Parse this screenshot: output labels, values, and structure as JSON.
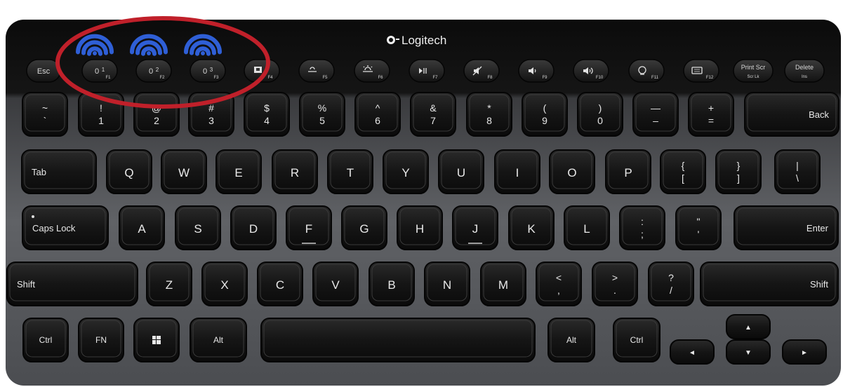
{
  "brand": {
    "name": "Logitech"
  },
  "colors": {
    "annotation_ring": "#c0202a",
    "bluetooth_wave": "#2f5fd6",
    "frame_top": "#0e0e0e",
    "frame_bottom": "#5a5c60",
    "key": "#141414"
  },
  "fn_row": [
    {
      "id": "esc",
      "label": "Esc",
      "sub": ""
    },
    {
      "id": "f1",
      "label": "0",
      "sup": "1",
      "sub": "F1"
    },
    {
      "id": "f2",
      "label": "0",
      "sup": "2",
      "sub": "F2"
    },
    {
      "id": "f3",
      "label": "0",
      "sup": "3",
      "sub": "F3"
    },
    {
      "id": "f4",
      "icon": "app-switch-icon",
      "sub": "F4"
    },
    {
      "id": "f5",
      "icon": "brightness-down-icon",
      "sub": "F5"
    },
    {
      "id": "f6",
      "icon": "brightness-up-icon",
      "sub": "F6"
    },
    {
      "id": "f7",
      "icon": "play-pause-icon",
      "sub": "F7"
    },
    {
      "id": "f8",
      "icon": "mute-icon",
      "sub": "F8"
    },
    {
      "id": "f9",
      "icon": "volume-down-icon",
      "sub": "F9"
    },
    {
      "id": "f10",
      "icon": "volume-up-icon",
      "sub": "F10"
    },
    {
      "id": "f11",
      "icon": "search-icon",
      "sub": "F11"
    },
    {
      "id": "f12",
      "icon": "keyboard-icon",
      "sub": "F12"
    },
    {
      "id": "prtscr",
      "label": "Print Scr",
      "sub": "Scr Lk"
    },
    {
      "id": "delete",
      "label": "Delete",
      "sub": "Ins"
    }
  ],
  "number_row": [
    {
      "top": "~",
      "bottom": "`"
    },
    {
      "top": "!",
      "bottom": "1"
    },
    {
      "top": "@",
      "bottom": "2"
    },
    {
      "top": "#",
      "bottom": "3"
    },
    {
      "top": "$",
      "bottom": "4"
    },
    {
      "top": "%",
      "bottom": "5"
    },
    {
      "top": "^",
      "bottom": "6"
    },
    {
      "top": "&",
      "bottom": "7"
    },
    {
      "top": "*",
      "bottom": "8"
    },
    {
      "top": "(",
      "bottom": "9"
    },
    {
      "top": ")",
      "bottom": "0"
    },
    {
      "top": "—",
      "bottom": "–"
    },
    {
      "top": "+",
      "bottom": "="
    },
    {
      "label": "Back"
    }
  ],
  "qwerty_row": [
    {
      "label": "Tab"
    },
    {
      "label": "Q"
    },
    {
      "label": "W"
    },
    {
      "label": "E"
    },
    {
      "label": "R"
    },
    {
      "label": "T"
    },
    {
      "label": "Y"
    },
    {
      "label": "U"
    },
    {
      "label": "I"
    },
    {
      "label": "O"
    },
    {
      "label": "P"
    },
    {
      "top": "{",
      "bottom": "["
    },
    {
      "top": "}",
      "bottom": "]"
    },
    {
      "top": "|",
      "bottom": "\\"
    }
  ],
  "home_row": [
    {
      "label": "Caps Lock"
    },
    {
      "label": "A"
    },
    {
      "label": "S"
    },
    {
      "label": "D"
    },
    {
      "label": "F"
    },
    {
      "label": "G"
    },
    {
      "label": "H"
    },
    {
      "label": "J"
    },
    {
      "label": "K"
    },
    {
      "label": "L"
    },
    {
      "top": ":",
      "bottom": ";"
    },
    {
      "top": "\"",
      "bottom": "'"
    },
    {
      "label": "Enter"
    }
  ],
  "shift_row": [
    {
      "label": "Shift"
    },
    {
      "label": "Z"
    },
    {
      "label": "X"
    },
    {
      "label": "C"
    },
    {
      "label": "V"
    },
    {
      "label": "B"
    },
    {
      "label": "N"
    },
    {
      "label": "M"
    },
    {
      "top": "<",
      "bottom": ","
    },
    {
      "top": ">",
      "bottom": "."
    },
    {
      "top": "?",
      "bottom": "/"
    },
    {
      "label": "Shift"
    }
  ],
  "bottom_row": [
    {
      "label": "Ctrl"
    },
    {
      "label": "FN"
    },
    {
      "icon": "windows-icon",
      "label": ""
    },
    {
      "label": "Alt"
    },
    {
      "label": ""
    },
    {
      "label": "Alt"
    },
    {
      "label": "Ctrl"
    }
  ],
  "arrows": {
    "up": "▲",
    "down": "▼",
    "left": "◄",
    "right": "►"
  }
}
